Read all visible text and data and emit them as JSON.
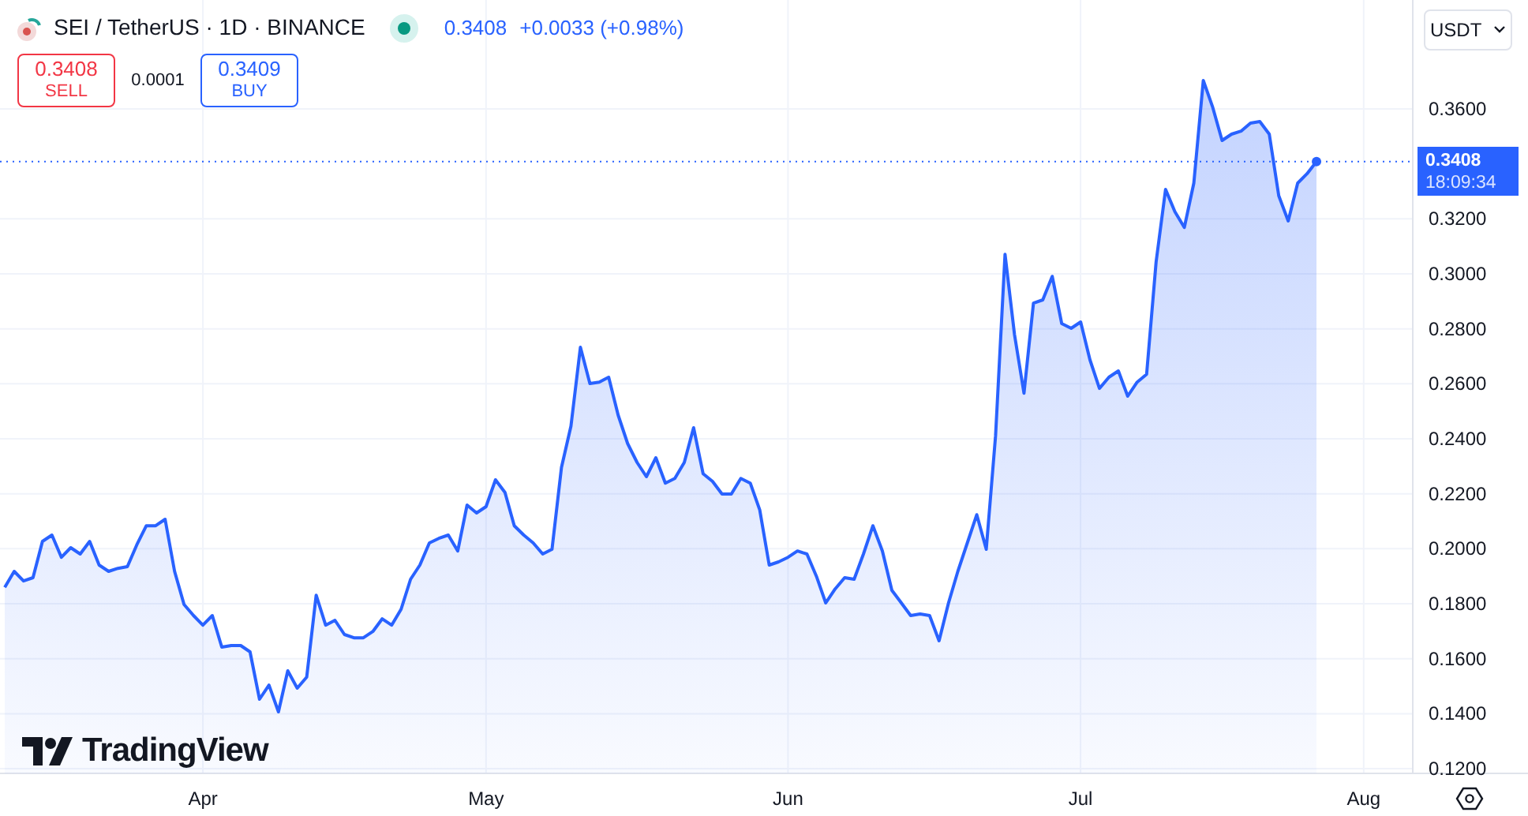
{
  "header": {
    "symbol": "SEI / TetherUS · 1D · BINANCE",
    "market_open": true,
    "price": "0.3408",
    "change": "+0.0033 (+0.98%)"
  },
  "trade": {
    "sell_price": "0.3408",
    "sell_label": "SELL",
    "spread": "0.0001",
    "buy_price": "0.3409",
    "buy_label": "BUY"
  },
  "currency": "USDT",
  "price_tag": {
    "price": "0.3408",
    "countdown": "18:09:34"
  },
  "logo": "TradingView",
  "chart_data": {
    "type": "area",
    "grid": true,
    "ref_lines": [
      {
        "axis": "y",
        "value": 0.3408
      }
    ],
    "ylim": [
      0.1183,
      0.3996
    ],
    "yticks": [
      {
        "value": 0.12,
        "label": "0.1200"
      },
      {
        "value": 0.14,
        "label": "0.1400"
      },
      {
        "value": 0.16,
        "label": "0.1600"
      },
      {
        "value": 0.18,
        "label": "0.1800"
      },
      {
        "value": 0.2,
        "label": "0.2000"
      },
      {
        "value": 0.22,
        "label": "0.2200"
      },
      {
        "value": 0.24,
        "label": "0.2400"
      },
      {
        "value": 0.26,
        "label": "0.2600"
      },
      {
        "value": 0.28,
        "label": "0.2800"
      },
      {
        "value": 0.3,
        "label": "0.3000"
      },
      {
        "value": 0.32,
        "label": "0.3200"
      },
      {
        "value": 0.36,
        "label": "0.3600"
      }
    ],
    "categories": [
      null,
      null,
      null,
      null,
      null,
      null,
      null,
      null,
      null,
      null,
      null,
      null,
      null,
      null,
      null,
      null,
      null,
      null,
      null,
      null,
      null,
      "Apr",
      null,
      null,
      null,
      null,
      null,
      null,
      null,
      null,
      null,
      null,
      null,
      null,
      null,
      null,
      null,
      null,
      null,
      null,
      null,
      null,
      null,
      null,
      null,
      null,
      null,
      null,
      null,
      null,
      null,
      "May",
      null,
      null,
      null,
      null,
      null,
      null,
      null,
      null,
      null,
      null,
      null,
      null,
      null,
      null,
      null,
      null,
      null,
      null,
      null,
      null,
      null,
      null,
      null,
      null,
      null,
      null,
      null,
      null,
      null,
      null,
      null,
      "Jun",
      null,
      null,
      null,
      null,
      null,
      null,
      null,
      null,
      null,
      null,
      null,
      null,
      null,
      null,
      null,
      null,
      null,
      null,
      null,
      null,
      null,
      null,
      null,
      null,
      null,
      null,
      null,
      null,
      null,
      null,
      "Jul",
      null,
      null,
      null,
      null,
      null,
      null,
      null,
      null,
      null,
      null,
      null,
      null,
      null,
      null,
      null,
      null,
      null,
      null,
      null,
      null,
      null,
      null,
      null,
      null,
      null,
      null,
      null,
      null,
      null,
      "Aug",
      null,
      null,
      null,
      null,
      null
    ],
    "series": [
      {
        "color": "#2962ff",
        "values": [
          0.186,
          0.1918,
          0.1883,
          0.1895,
          0.2027,
          0.205,
          0.1969,
          0.2004,
          0.1981,
          0.2027,
          0.1941,
          0.1918,
          0.1929,
          0.1935,
          0.2015,
          0.2084,
          0.2084,
          0.2107,
          0.1918,
          0.1797,
          0.1757,
          0.1722,
          0.1757,
          0.1642,
          0.1648,
          0.1648,
          0.1625,
          0.1453,
          0.1504,
          0.1407,
          0.1556,
          0.1493,
          0.1533,
          0.1831,
          0.1722,
          0.174,
          0.1688,
          0.1676,
          0.1676,
          0.1699,
          0.1745,
          0.1722,
          0.178,
          0.1889,
          0.1941,
          0.2021,
          0.2038,
          0.205,
          0.1992,
          0.2159,
          0.213,
          0.2153,
          0.2251,
          0.2205,
          0.2084,
          0.205,
          0.2021,
          0.1981,
          0.1998,
          0.2296,
          0.2446,
          0.2733,
          0.2601,
          0.2606,
          0.2624,
          0.2486,
          0.2383,
          0.2314,
          0.2262,
          0.2331,
          0.2239,
          0.2256,
          0.2314,
          0.244,
          0.2273,
          0.2245,
          0.2199,
          0.2199,
          0.2256,
          0.2239,
          0.2141,
          0.1941,
          0.1952,
          0.1969,
          0.1992,
          0.1981,
          0.19,
          0.1803,
          0.1854,
          0.1895,
          0.1889,
          0.1981,
          0.2084,
          0.1992,
          0.1849,
          0.1803,
          0.1757,
          0.1763,
          0.1757,
          0.1665,
          0.1803,
          0.1918,
          0.2021,
          0.2124,
          0.1998,
          0.2411,
          0.3071,
          0.2779,
          0.2566,
          0.2893,
          0.2905,
          0.2991,
          0.2819,
          0.2802,
          0.2825,
          0.2687,
          0.2583,
          0.2624,
          0.2647,
          0.2555,
          0.2606,
          0.2635,
          0.3043,
          0.3307,
          0.3226,
          0.3169,
          0.333,
          0.3703,
          0.3605,
          0.3485,
          0.3508,
          0.3519,
          0.3548,
          0.3554,
          0.3508,
          0.3284,
          0.3192,
          0.333,
          0.3364,
          0.3408,
          null,
          null,
          null,
          null,
          null,
          null,
          null,
          null,
          null,
          null
        ]
      }
    ]
  }
}
